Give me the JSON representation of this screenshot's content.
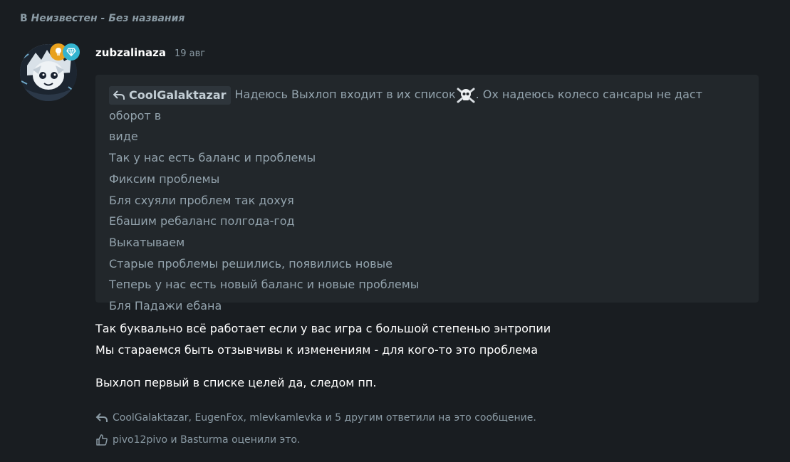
{
  "thread": {
    "prefix": "В",
    "title": "Неизвестен - Без названия"
  },
  "post": {
    "author": "zubzalinaza",
    "date": "19 авг",
    "badges": [
      "bulb-icon",
      "diamond-icon"
    ],
    "quote": {
      "author": "CoolGalaktazar",
      "first_line": "Надеюсь Выхлоп входит в их список",
      "first_line_rest": ". Ох надеюсь колесо сансары не даст оборот в",
      "lines": [
        "виде",
        "Так у нас есть баланс и проблемы",
        "Фиксим проблемы",
        "Бля схуяли проблем так дохуя",
        "Ебашим ребаланс полгода-год",
        "Выкатываем",
        "Старые проблемы решились, появились новые",
        "Теперь у нас есть новый баланс и новые проблемы",
        "Бля Падажи ебана"
      ],
      "emoji": "skull-crossbones-icon"
    },
    "body": {
      "line1": "Так буквально всё работает если у вас игра с большой степенью энтропии",
      "line2": "Мы стараемся быть отзывчивы к изменениям - для кого-то это проблема",
      "line3": "Выхлоп первый в списке целей да, следом пп."
    },
    "replies_text": "CoolGalaktazar, EugenFox, mlevkamlevka и 5 другим ответили на это сообщение.",
    "likes_text": "pivo12pivo и Basturma оценили это."
  }
}
